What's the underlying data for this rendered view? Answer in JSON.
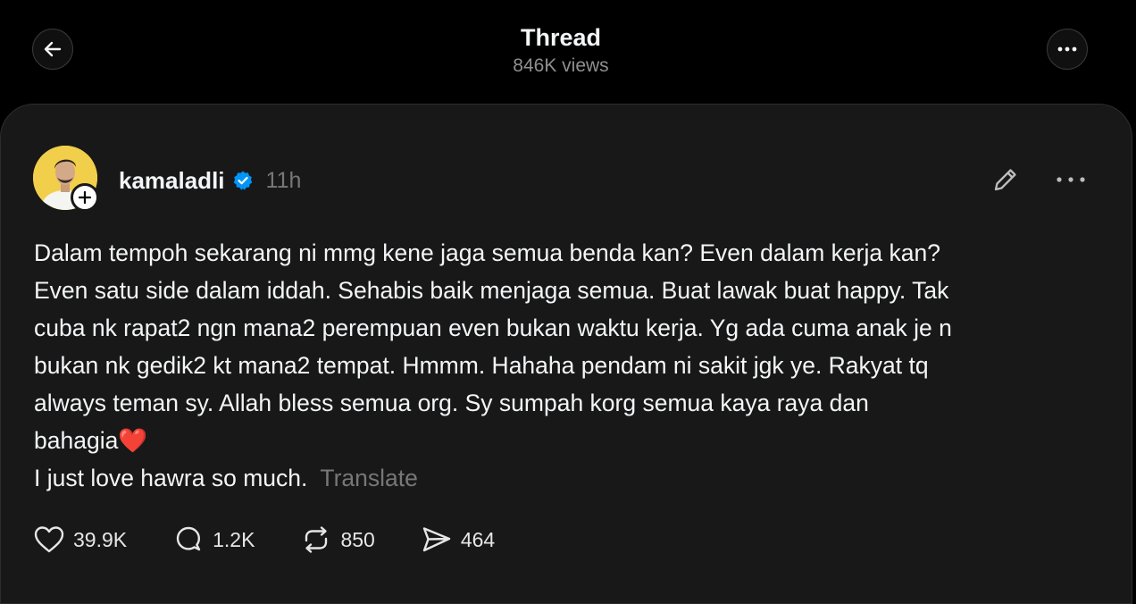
{
  "header": {
    "title": "Thread",
    "views": "846K views",
    "back_icon": "arrow-left-icon",
    "more_icon": "more-horizontal-icon"
  },
  "post": {
    "username": "kamaladli",
    "verified_icon": "verified-badge-icon",
    "time": "11h",
    "edit_icon": "pencil-icon",
    "more_icon": "more-horizontal-icon",
    "lines": [
      "Dalam tempoh sekarang ni mmg kene jaga semua benda kan? Even dalam kerja kan?",
      "Even satu side dalam iddah. Sehabis baik menjaga semua. Buat lawak buat happy. Tak",
      "cuba nk rapat2 ngn mana2 perempuan even bukan waktu kerja. Yg ada cuma anak je n",
      "bukan nk gedik2 kt mana2 tempat. Hmmm. Hahaha pendam ni sakit jgk ye. Rakyat tq",
      "always teman sy. Allah bless semua org. Sy sumpah korg semua kaya raya dan",
      "bahagia❤️",
      "I just love hawra so much."
    ],
    "translate_label": "Translate",
    "actions": {
      "likes": "39.9K",
      "replies": "1.2K",
      "reposts": "850",
      "shares": "464"
    }
  },
  "colors": {
    "background": "#000000",
    "card": "#181818",
    "text": "#f3f5f7",
    "muted": "#777777",
    "verified": "#0095f6",
    "avatar_bg": "#f2cf4a"
  }
}
